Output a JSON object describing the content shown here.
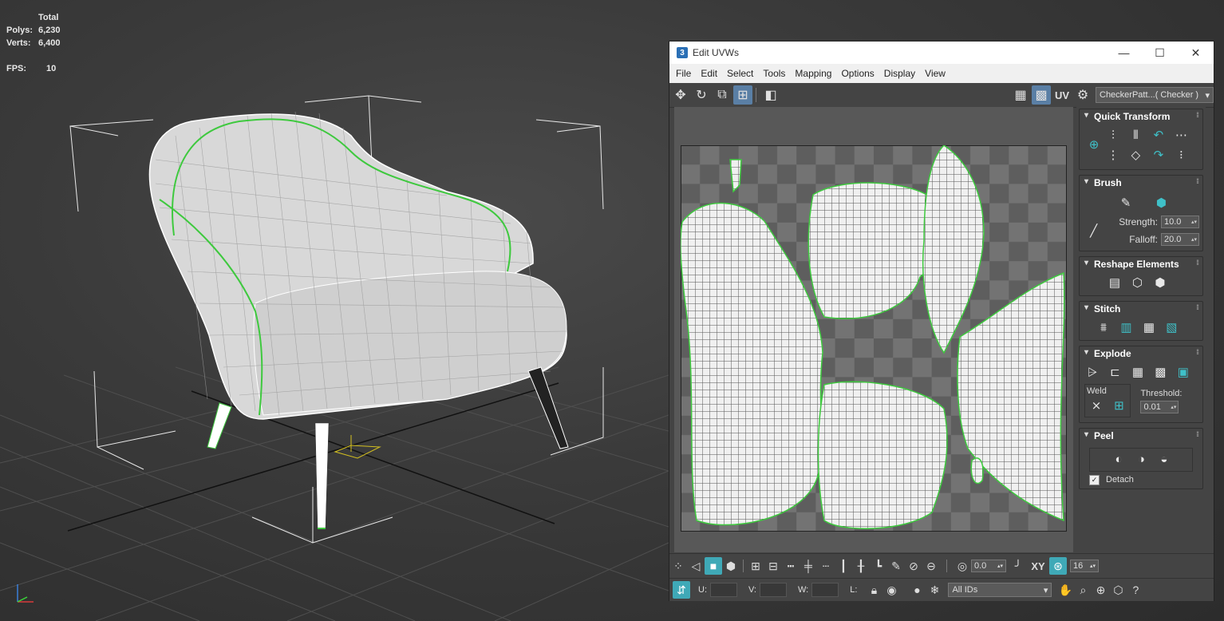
{
  "viewport": {
    "stats": {
      "header": "Total",
      "polys_label": "Polys:",
      "polys_value": "6,230",
      "verts_label": "Verts:",
      "verts_value": "6,400",
      "fps_label": "FPS:",
      "fps_value": "10"
    }
  },
  "uvw_window": {
    "title": "Edit UVWs",
    "app_icon": "3",
    "window_buttons": {
      "minimize": "—",
      "maximize": "☐",
      "close": "✕"
    },
    "menu": [
      "File",
      "Edit",
      "Select",
      "Tools",
      "Mapping",
      "Options",
      "Display",
      "View"
    ],
    "toolbar": {
      "uv_label": "UV",
      "texture_select": "CheckerPatt...( Checker )"
    },
    "panel": {
      "quick_transform": {
        "title": "Quick Transform"
      },
      "brush": {
        "title": "Brush",
        "strength_label": "Strength:",
        "strength_value": "10.0",
        "falloff_label": "Falloff:",
        "falloff_value": "20.0"
      },
      "reshape": {
        "title": "Reshape Elements"
      },
      "stitch": {
        "title": "Stitch"
      },
      "explode": {
        "title": "Explode",
        "weld_label": "Weld",
        "threshold_label": "Threshold:",
        "threshold_value": "0.01"
      },
      "peel": {
        "title": "Peel",
        "detach_label": "Detach"
      }
    },
    "bottom1": {
      "angle_value": "0.0",
      "xy_label": "XY",
      "grid_value": "16"
    },
    "bottom2": {
      "u_label": "U:",
      "v_label": "V:",
      "w_label": "W:",
      "l_label": "L:",
      "ids_select": "All IDs"
    }
  },
  "colors": {
    "selection_green": "#3ec93e",
    "accent_teal": "#3fc0c8",
    "gizmo_yellow": "#d4c020"
  }
}
